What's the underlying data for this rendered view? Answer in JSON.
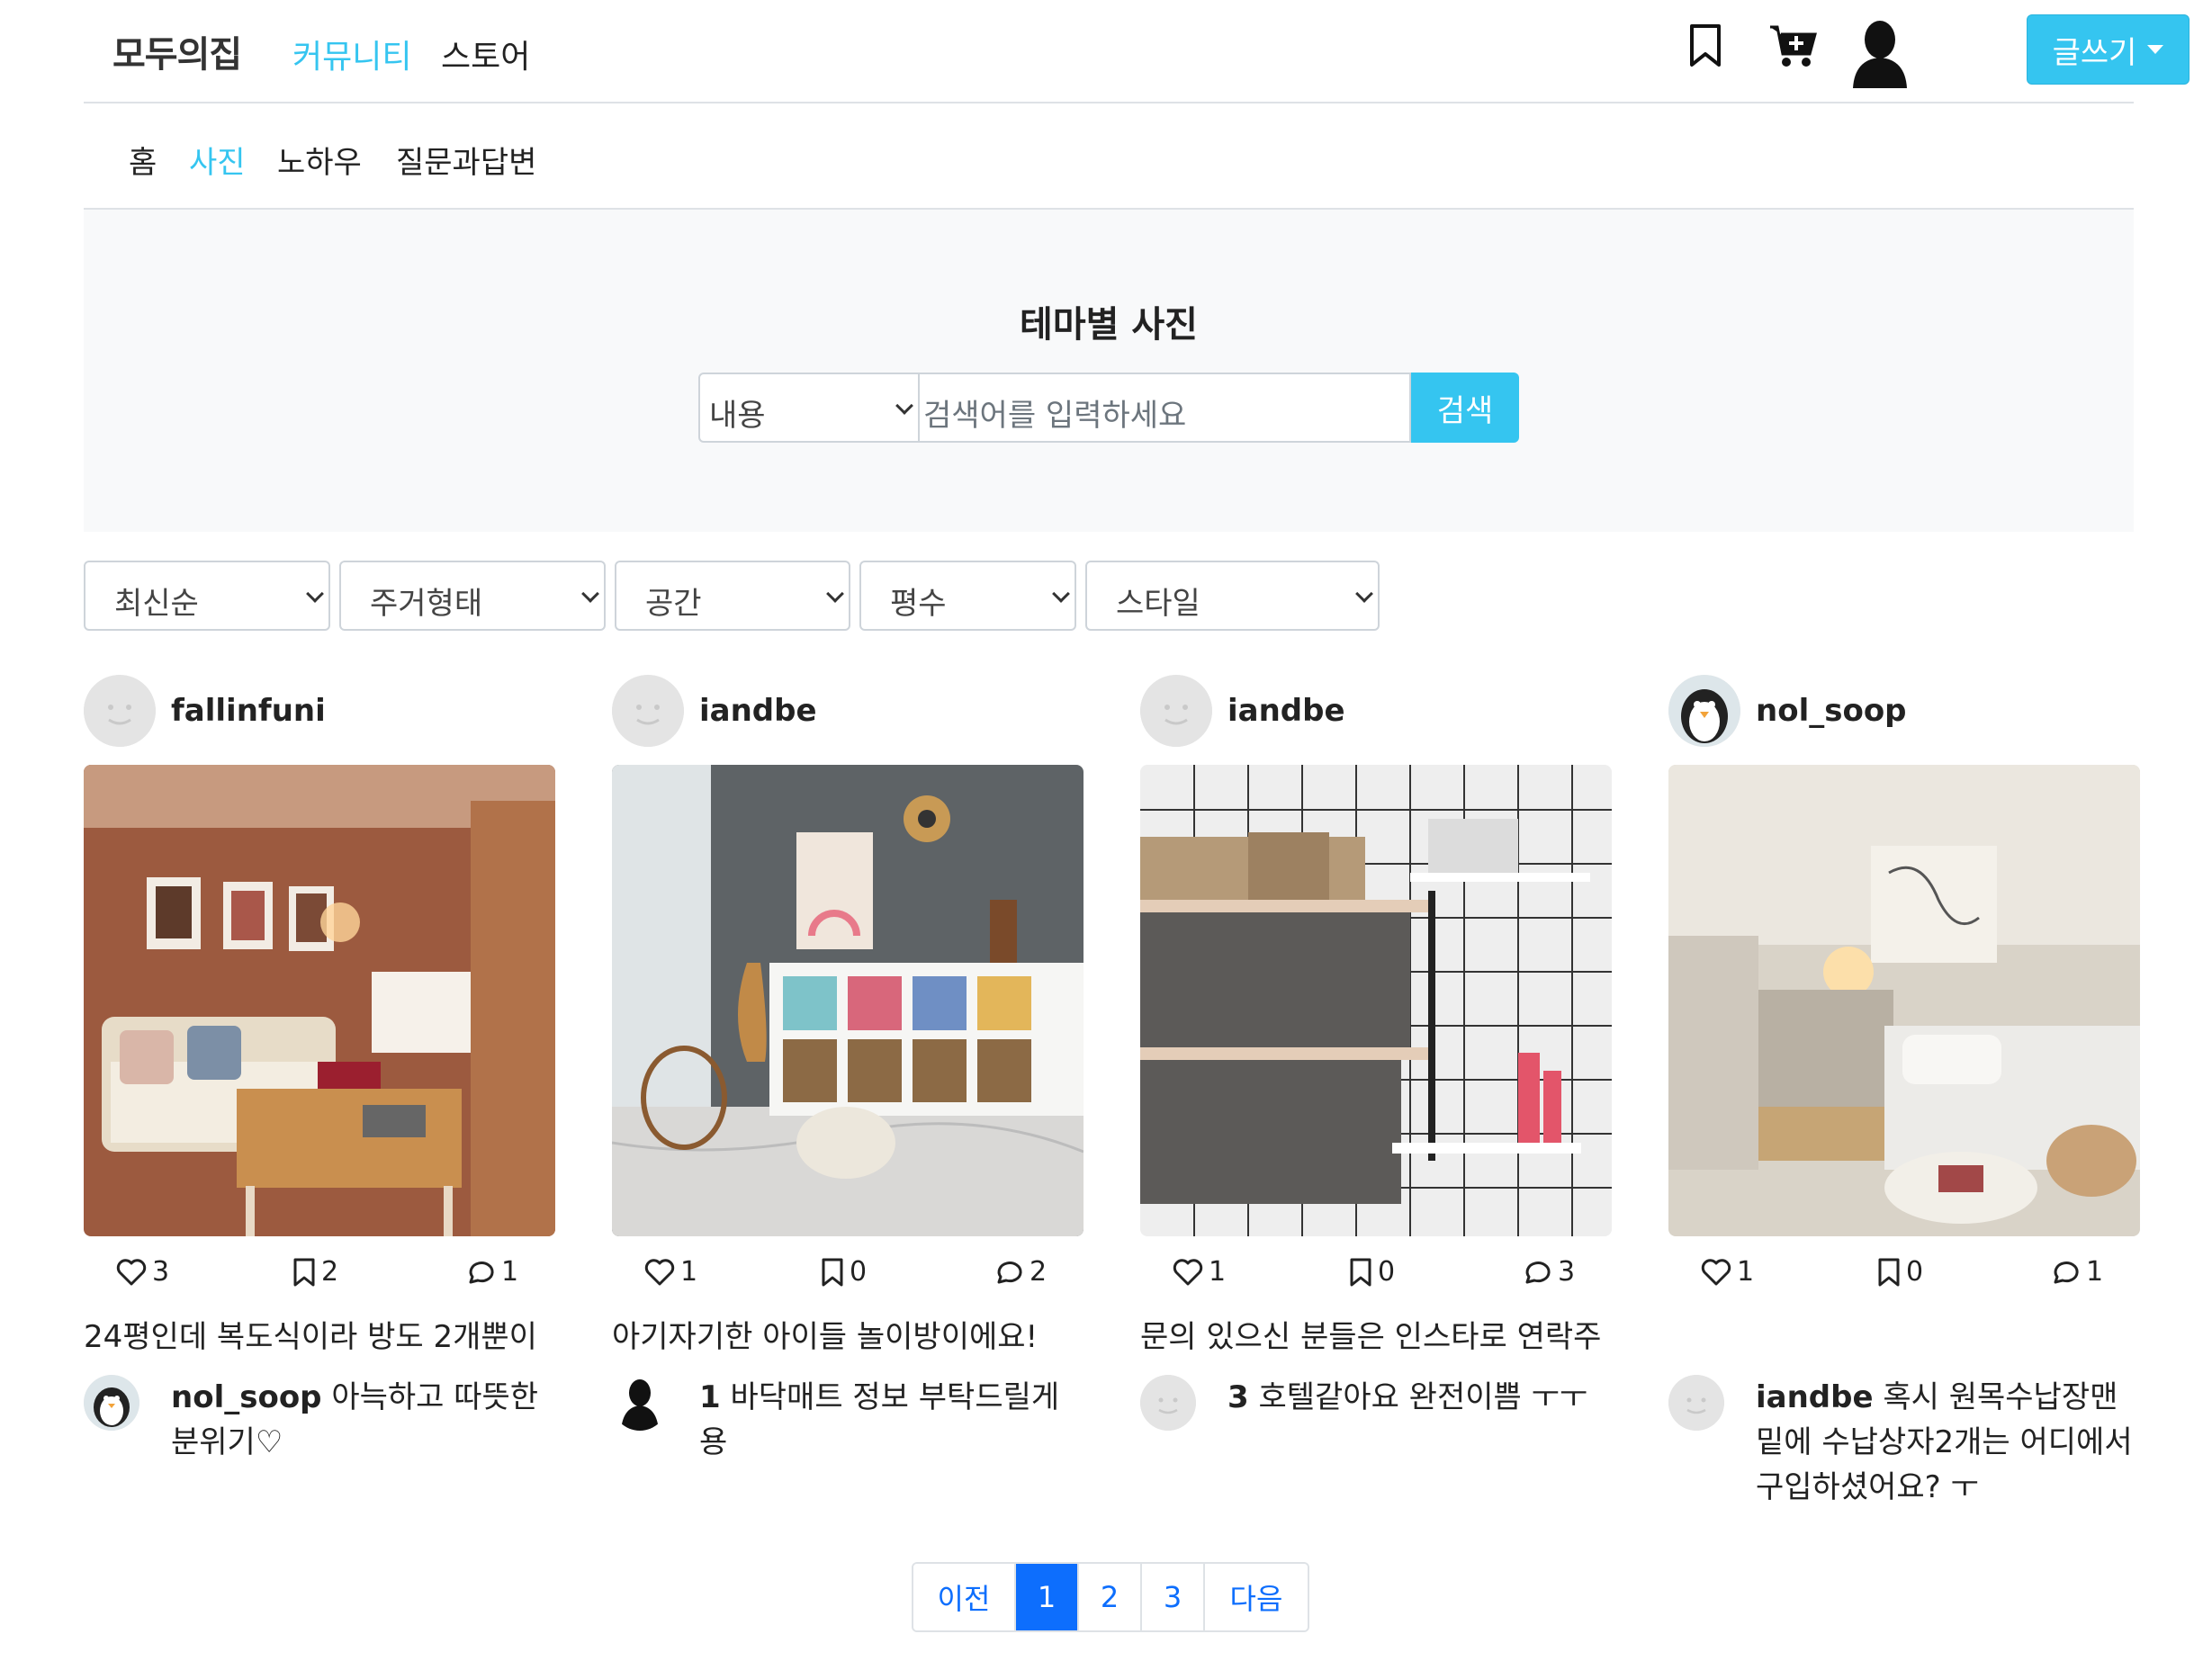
{
  "header": {
    "logo": "모두의집",
    "nav": [
      "커뮤니티",
      "스토어"
    ],
    "write_button": "글쓰기"
  },
  "subnav": [
    "홈",
    "사진",
    "노하우",
    "질문과답변"
  ],
  "search": {
    "title": "테마별 사진",
    "select_value": "내용",
    "placeholder": "검색어를 입력하세요",
    "button": "검색"
  },
  "filters": [
    "최신순",
    "주거형태",
    "공간",
    "평수",
    "스타일"
  ],
  "posts": [
    {
      "user": "fallinfuni",
      "avatar": "default-face",
      "likes": "3",
      "bookmarks": "2",
      "comments": "1",
      "caption": "24평인데 복도식이라 방도 2개뿐이",
      "comment_user": "nol_soop",
      "comment_avatar": "penguin",
      "comment_text": " 아늑하고 따뜻한 분위기♡"
    },
    {
      "user": "iandbe",
      "avatar": "default-face",
      "likes": "1",
      "bookmarks": "0",
      "comments": "2",
      "caption": "아기자기한 아이들 놀이방이에요!",
      "comment_user": "1",
      "comment_avatar": "person-silhouette",
      "comment_text": " 바닥매트 정보 부탁드릴게용"
    },
    {
      "user": "iandbe",
      "avatar": "default-face",
      "likes": "1",
      "bookmarks": "0",
      "comments": "3",
      "caption": "문의 있으신 분들은 인스타로 연락주",
      "comment_user": "3",
      "comment_avatar": "default-face",
      "comment_text": " 호텔같아요 완전이쁨 ㅜㅜ"
    },
    {
      "user": "nol_soop",
      "avatar": "penguin",
      "likes": "1",
      "bookmarks": "0",
      "comments": "1",
      "caption": "",
      "comment_user": "iandbe",
      "comment_avatar": "default-face",
      "comment_text": " 혹시 원목수납장맨밑에 수납상자2개는 어디에서 구입하셨어요? ㅜ"
    }
  ],
  "pagination": [
    "이전",
    "1",
    "2",
    "3",
    "다음"
  ],
  "colors": {
    "accent": "#35c5f0",
    "page_active": "#0d6efd"
  }
}
